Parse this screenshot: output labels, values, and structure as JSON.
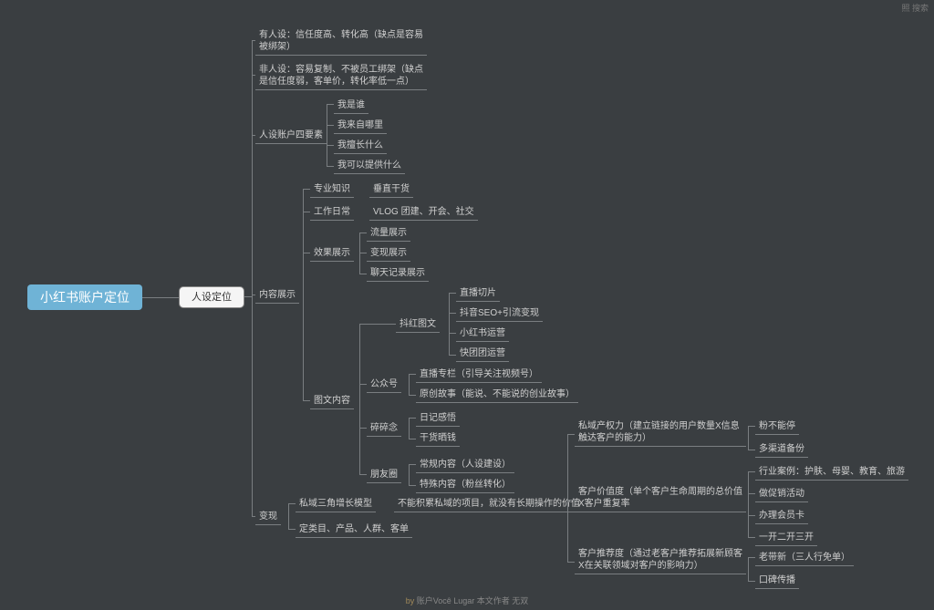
{
  "root": "小红书账户定位",
  "lvl2": "人设定位",
  "n": {
    "a1": "有人设：信任度高、转化高（缺点是容易被绑架）",
    "a2": "非人设：容易复制、不被员工绑架（缺点是信任度弱，客单价，转化率低一点）",
    "a3": "人设账户四要素",
    "a3_1": "我是谁",
    "a3_2": "我来自哪里",
    "a3_3": "我擅长什么",
    "a3_4": "我可以提供什么",
    "b": "内容展示",
    "b1": "专业知识",
    "b1x": "垂直干货",
    "b2": "工作日常",
    "b2x": "VLOG 团建、开会、社交",
    "b3": "效果展示",
    "b3_1": "流量展示",
    "b3_2": "变现展示",
    "b3_3": "聊天记录展示",
    "b4": "抖红图文",
    "b4_1": "直播切片",
    "b4_2": "抖音SEO+引流变现",
    "b4_3": "小红书运营",
    "b4_4": "快团团运营",
    "b5": "图文内容",
    "b5a": "公众号",
    "b5a_1": "直播专栏（引导关注视频号）",
    "b5a_2": "原创故事（能说、不能说的创业故事）",
    "b5b": "碎碎念",
    "b5b_1": "日记感悟",
    "b5b_2": "干货晒钱",
    "b5c": "朋友圈",
    "b5c_1": "常规内容（人设建设）",
    "b5c_2": "特殊内容（粉丝转化）",
    "c": "变现",
    "c1": "私域三角增长模型",
    "c1x": "不能积累私域的项目，就没有长期操作的价值",
    "c2": "定类目、产品、人群、客单",
    "d1": "私域产权力（建立链接的用户数量X信息触达客户的能力）",
    "d1_1": "粉不能停",
    "d1_2": "多渠道备份",
    "d2": "客户价值度（单个客户生命周期的总价值X客户重复率",
    "d2_1": "行业案例：护肤、母婴、教育、旅游",
    "d2_2": "做促销活动",
    "d2_3": "办理会员卡",
    "d2_4": "一开二开三开",
    "d3": "客户推荐度（通过老客户推荐拓展新顾客X在关联领域对客户的影响力）",
    "d3_1": "老带新（三人行免单）",
    "d3_2": "口碑传播"
  },
  "footer_by": "by",
  "footer_txt": "账户Você Lugar 本文作者 无双",
  "topright": "照 搜索"
}
